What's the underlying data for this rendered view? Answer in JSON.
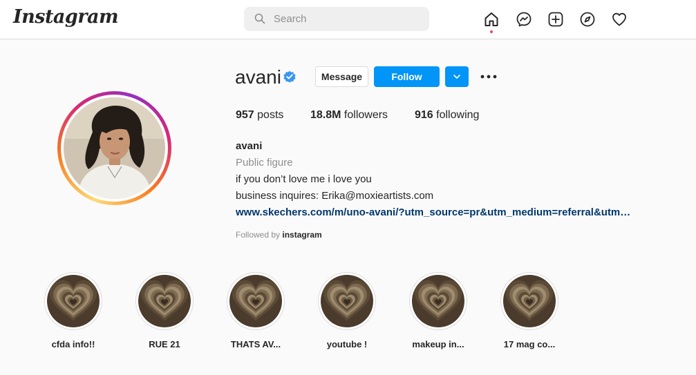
{
  "header": {
    "logo": "Instagram",
    "search_placeholder": "Search",
    "nav_icons": [
      "home-icon",
      "messenger-icon",
      "new-post-icon",
      "explore-icon",
      "activity-heart-icon"
    ]
  },
  "profile": {
    "username": "avani",
    "verified": true,
    "buttons": {
      "message": "Message",
      "follow": "Follow"
    },
    "stats": {
      "posts_count": "957",
      "posts_label": "posts",
      "followers_count": "18.8M",
      "followers_label": "followers",
      "following_count": "916",
      "following_label": "following"
    },
    "full_name": "avani",
    "category": "Public figure",
    "bio_line1": "if you don’t love me i love you",
    "bio_line2": "business inquires: Erika@moxieartists.com",
    "link": "www.skechers.com/m/uno-avani/?utm_source=pr&utm_medium=referral&utm…",
    "followed_by_prefix": "Followed by",
    "followed_by_user": "instagram"
  },
  "highlights": [
    {
      "label": "cfda info!!"
    },
    {
      "label": "RUE 21"
    },
    {
      "label": "THATS AV..."
    },
    {
      "label": "youtube !"
    },
    {
      "label": "makeup in..."
    },
    {
      "label": "17 mag co..."
    }
  ],
  "colors": {
    "accent": "#0095f6",
    "link": "#00376b",
    "verified": "#3897f0",
    "notification_dot": "#ed4956",
    "background": "#fafafa"
  }
}
